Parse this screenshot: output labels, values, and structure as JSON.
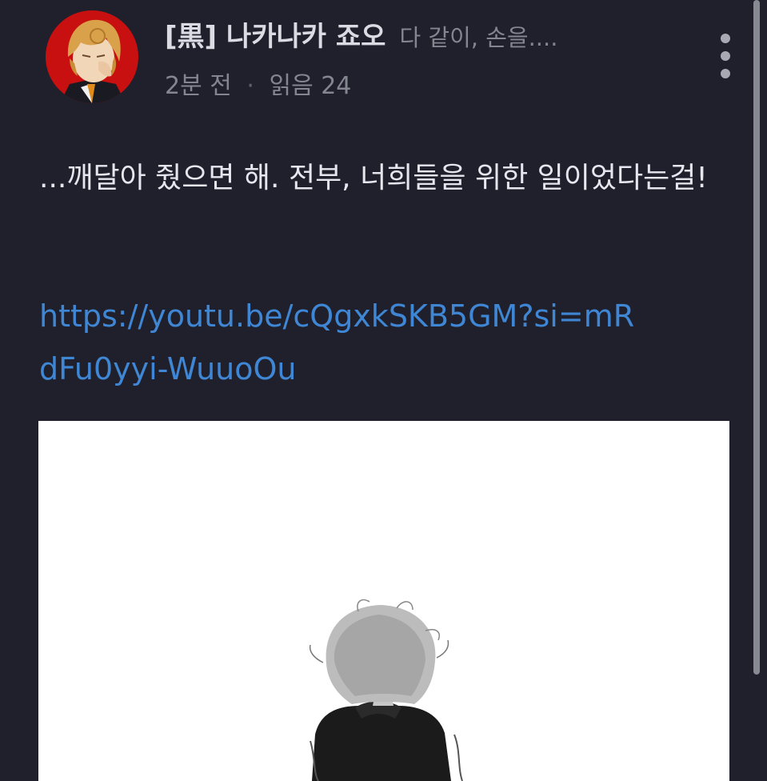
{
  "post": {
    "author_name": "[黒] 나카나카 죠오",
    "preview": "다 같이, 손을....",
    "time": "2분 전",
    "separator": "·",
    "reads": "읽음 24",
    "body": "...깨달아 줬으면 해. 전부, 너희들을 위한 일이었다는걸!",
    "link": "https://youtu.be/cQgxkSKB5GM?si=mRdFu0yyi-WuuoOu"
  },
  "icons": {
    "more": "more-vertical-icon"
  },
  "colors": {
    "background": "#1f202b",
    "link": "#3f86d4",
    "avatar_background": "#c81010"
  }
}
